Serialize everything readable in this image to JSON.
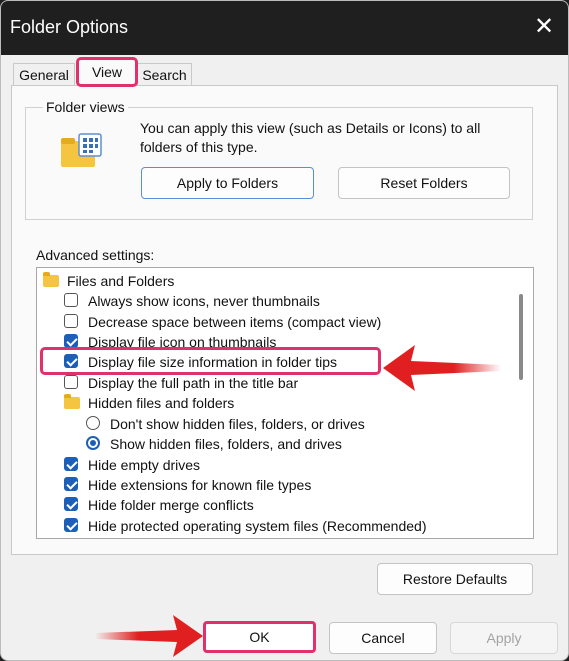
{
  "window": {
    "title": "Folder Options"
  },
  "tabs": [
    {
      "label": "General"
    },
    {
      "label": "View"
    },
    {
      "label": "Search"
    }
  ],
  "folder_views": {
    "label": "Folder views",
    "description": "You can apply this view (such as Details or Icons) to all folders of this type.",
    "apply_button": "Apply to Folders",
    "reset_button": "Reset Folders"
  },
  "advanced": {
    "label": "Advanced settings:",
    "items": [
      {
        "type": "folder",
        "label": "Files and Folders"
      },
      {
        "type": "checkbox",
        "checked": false,
        "label": "Always show icons, never thumbnails"
      },
      {
        "type": "checkbox",
        "checked": false,
        "label": "Decrease space between items (compact view)"
      },
      {
        "type": "checkbox",
        "checked": true,
        "label": "Display file icon on thumbnails"
      },
      {
        "type": "checkbox",
        "checked": true,
        "label": "Display file size information in folder tips"
      },
      {
        "type": "checkbox",
        "checked": false,
        "label": "Display the full path in the title bar"
      },
      {
        "type": "folder",
        "label": "Hidden files and folders"
      },
      {
        "type": "radio",
        "checked": false,
        "label": "Don't show hidden files, folders, or drives"
      },
      {
        "type": "radio",
        "checked": true,
        "label": "Show hidden files, folders, and drives"
      },
      {
        "type": "checkbox",
        "checked": true,
        "label": "Hide empty drives"
      },
      {
        "type": "checkbox",
        "checked": true,
        "label": "Hide extensions for known file types"
      },
      {
        "type": "checkbox",
        "checked": true,
        "label": "Hide folder merge conflicts"
      },
      {
        "type": "checkbox",
        "checked": true,
        "label": "Hide protected operating system files (Recommended)"
      }
    ]
  },
  "buttons": {
    "restore": "Restore Defaults",
    "ok": "OK",
    "cancel": "Cancel",
    "apply": "Apply"
  },
  "colors": {
    "highlight": "#e1306c",
    "arrow": "#e02020",
    "accent": "#1d5fb8"
  }
}
